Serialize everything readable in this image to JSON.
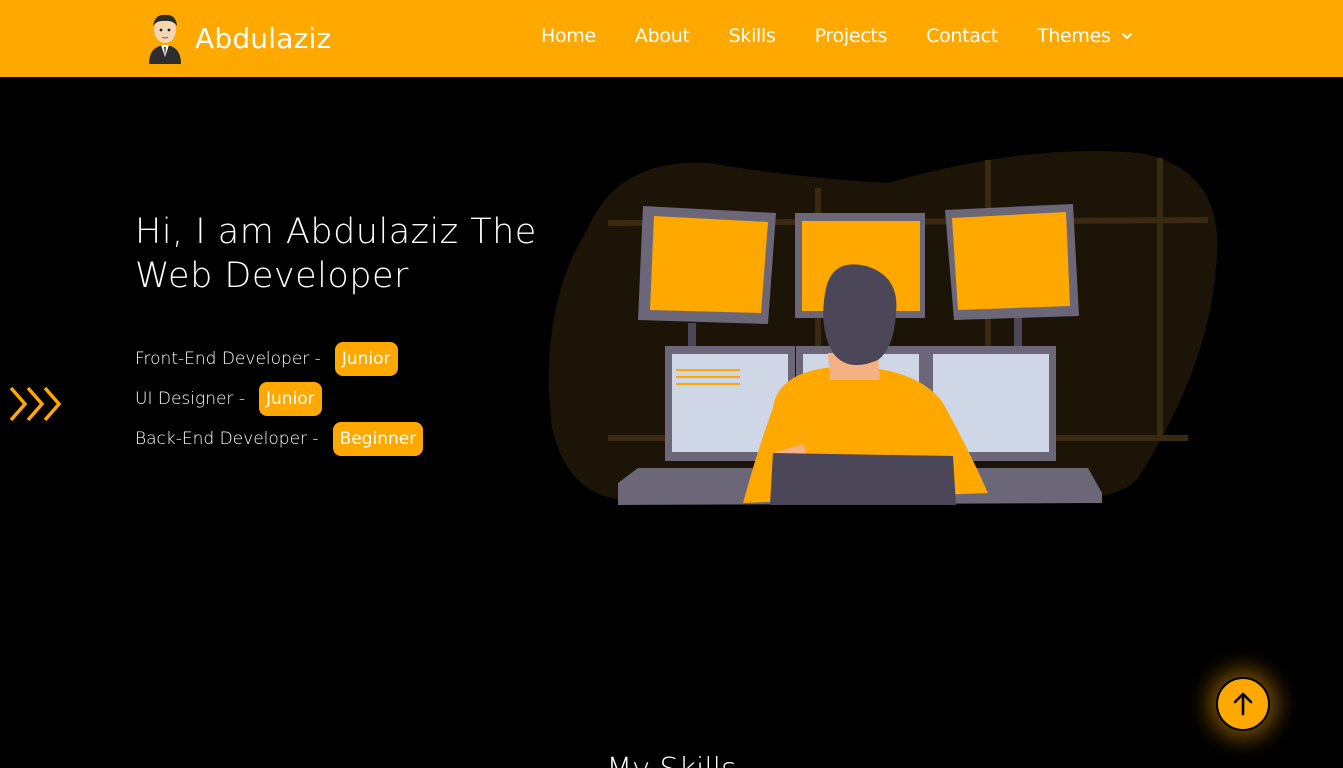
{
  "brand": {
    "name": "Abdulaziz",
    "avatar_icon": "developer-avatar-icon"
  },
  "nav": {
    "items": [
      {
        "label": "Home"
      },
      {
        "label": "About"
      },
      {
        "label": "Skills"
      },
      {
        "label": "Projects"
      },
      {
        "label": "Contact"
      }
    ],
    "themes_label": "Themes"
  },
  "hero": {
    "title": "Hi, I am Abdulaziz The Web Developer",
    "roles": [
      {
        "label": "Front-End Developer -",
        "level": "Junior"
      },
      {
        "label": "UI Designer -",
        "level": "Junior"
      },
      {
        "label": "Back-End Developer -",
        "level": "Beginner"
      }
    ]
  },
  "next_section": {
    "heading_partial": "My Skills"
  },
  "colors": {
    "accent": "#ffa800",
    "background": "#000000",
    "text": "#ffffff"
  },
  "icons": {
    "scroll_top": "arrow-up-icon",
    "decor": "double-chevron-right-icon",
    "dropdown": "chevron-down-icon"
  }
}
